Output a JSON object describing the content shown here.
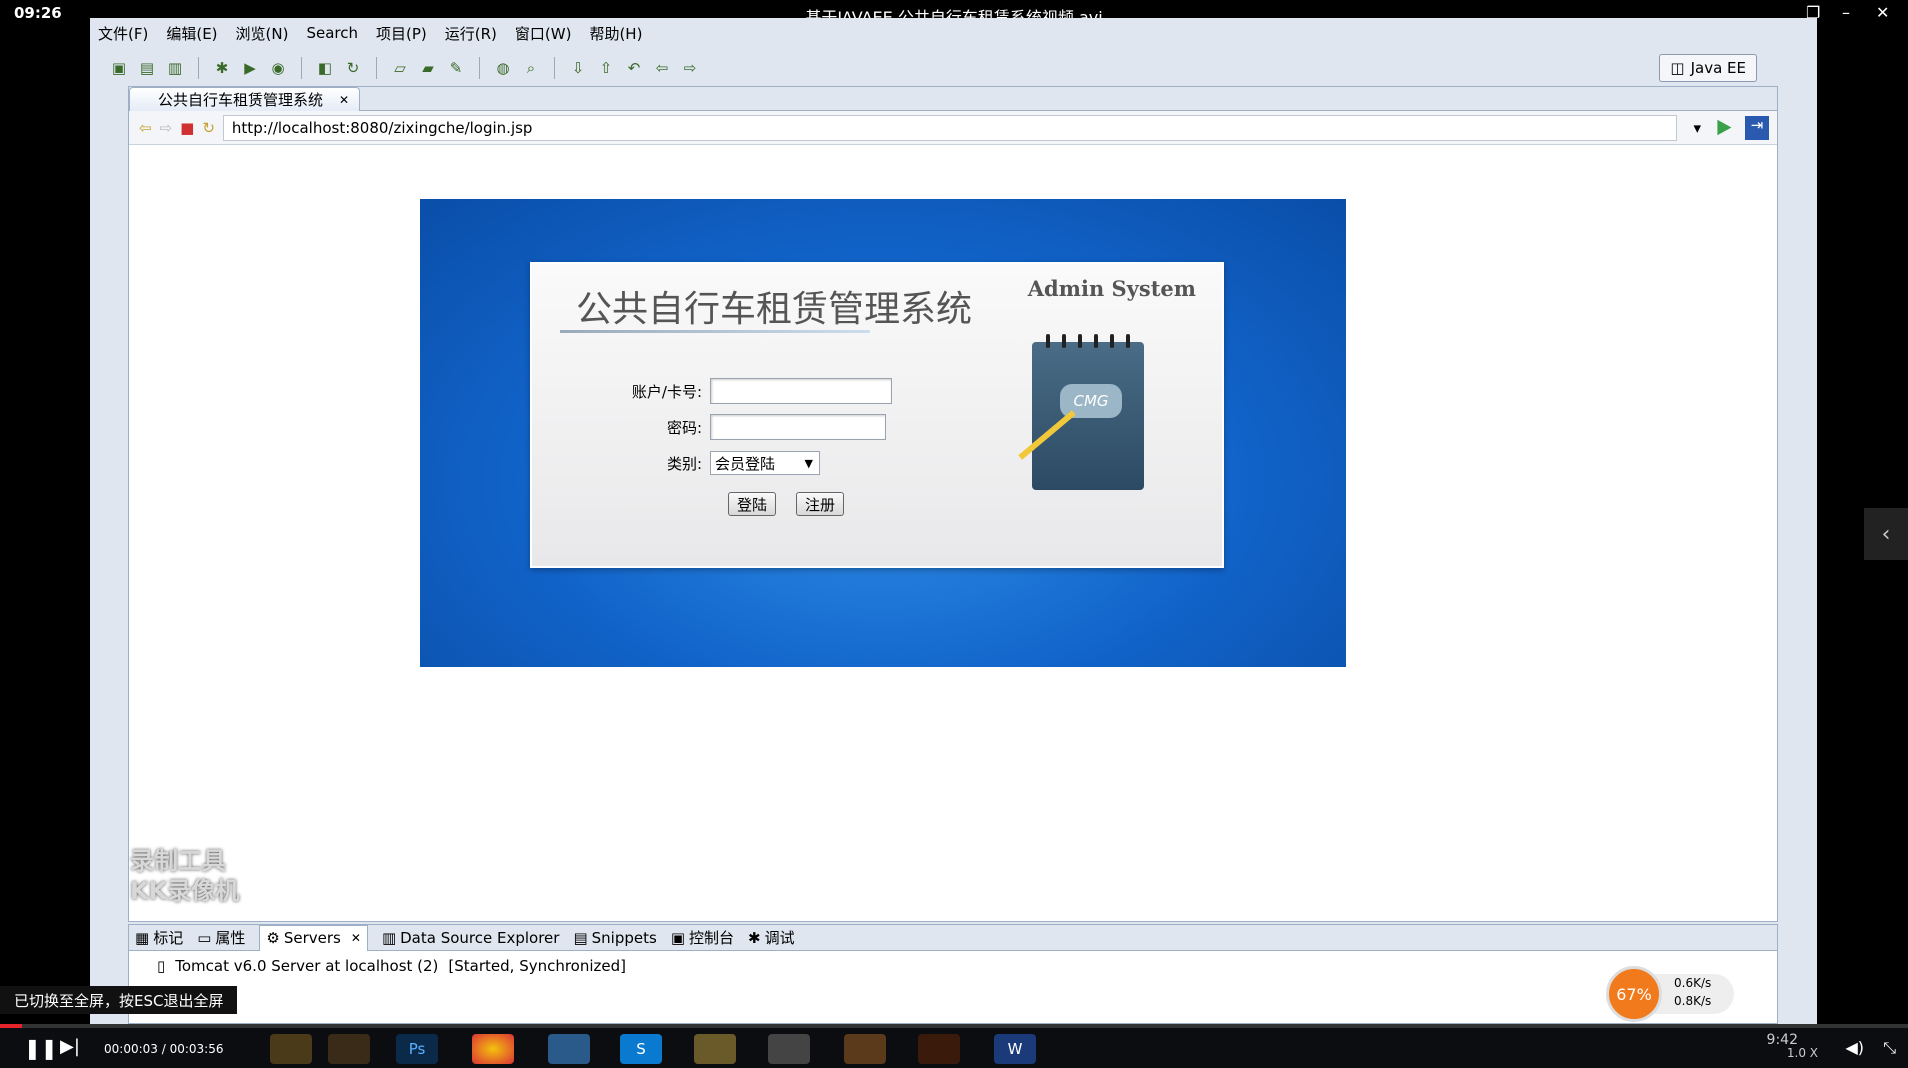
{
  "player": {
    "clock": "09:26",
    "title": "基于JAVAEE 公共自行车租赁系统视频.avi",
    "time": "00:00:03 / 00:03:56",
    "speed": "1.0 X",
    "toast": "已切换至全屏，按ESC退出全屏"
  },
  "menu": [
    "文件(F)",
    "编辑(E)",
    "浏览(N)",
    "Search",
    "项目(P)",
    "运行(R)",
    "窗口(W)",
    "帮助(H)"
  ],
  "perspective": "Java EE",
  "editor_tab": "公共自行车租赁管理系统",
  "url": "http://localhost:8080/zixingche/login.jsp",
  "login": {
    "title": "公共自行车租赁管理系统",
    "admin": "Admin System",
    "notebook_text": "CMG",
    "account_label": "账户/卡号:",
    "password_label": "密码:",
    "type_label": "类别:",
    "type_value": "会员登陆",
    "login_btn": "登陆",
    "register_btn": "注册"
  },
  "bottom_tabs": [
    "标记",
    "属性",
    "Servers",
    "Data Source Explorer",
    "Snippets",
    "控制台",
    "调试"
  ],
  "server": {
    "name": "Tomcat v6.0 Server at localhost (2)",
    "status": "[Started, Synchronized]"
  },
  "watermark": [
    "录制工具",
    "KK录像机"
  ],
  "net": {
    "percent": "67%",
    "up": "0.6K/s",
    "down": "0.8K/s"
  },
  "tray_time": "9:42"
}
